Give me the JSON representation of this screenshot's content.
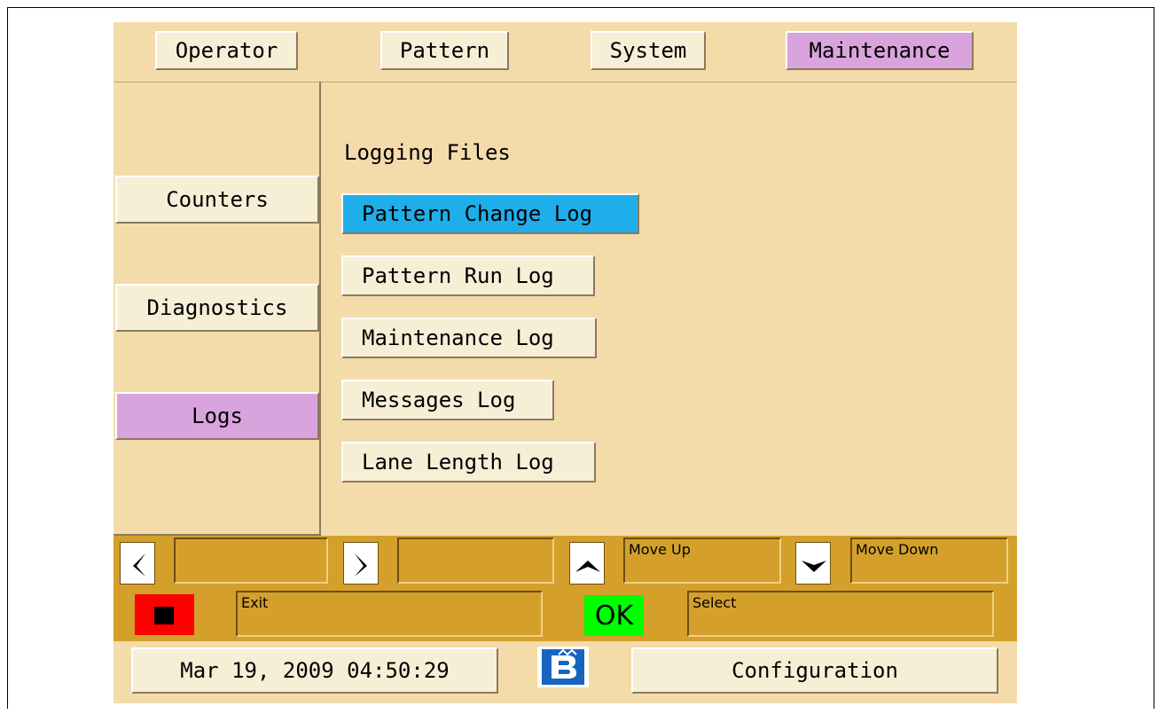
{
  "tabs": [
    {
      "label": "Operator",
      "active": false
    },
    {
      "label": "Pattern",
      "active": false
    },
    {
      "label": "System",
      "active": false
    },
    {
      "label": "Maintenance",
      "active": true
    }
  ],
  "sidebar": {
    "items": [
      {
        "label": "Counters",
        "active": false
      },
      {
        "label": "Diagnostics",
        "active": false
      },
      {
        "label": "Logs",
        "active": true
      }
    ]
  },
  "main": {
    "title": "Logging Files",
    "logs": [
      {
        "label": "Pattern Change Log",
        "selected": true
      },
      {
        "label": "Pattern Run Log",
        "selected": false
      },
      {
        "label": "Maintenance Log",
        "selected": false
      },
      {
        "label": "Messages Log",
        "selected": false
      },
      {
        "label": "Lane Length Log",
        "selected": false
      }
    ]
  },
  "softkeys": {
    "left_label": "",
    "right_label": "",
    "up_label": "Move Up",
    "down_label": "Move Down",
    "exit_label": "Exit",
    "ok_text": "OK",
    "select_label": "Select"
  },
  "footer": {
    "datetime": "Mar 19, 2009 04:50:29",
    "logo_icon": "brunswick-logo-icon",
    "config_label": "Configuration"
  },
  "colors": {
    "screen_bg": "#f4dcaa",
    "button_bg": "#f6efd6",
    "active_tab": "#d9a4dd",
    "selected_item": "#1eaee9",
    "softkey_bar": "#d4a02b",
    "stop_red": "#ff0000",
    "ok_green": "#00ff00",
    "logo_blue": "#1565c0"
  }
}
